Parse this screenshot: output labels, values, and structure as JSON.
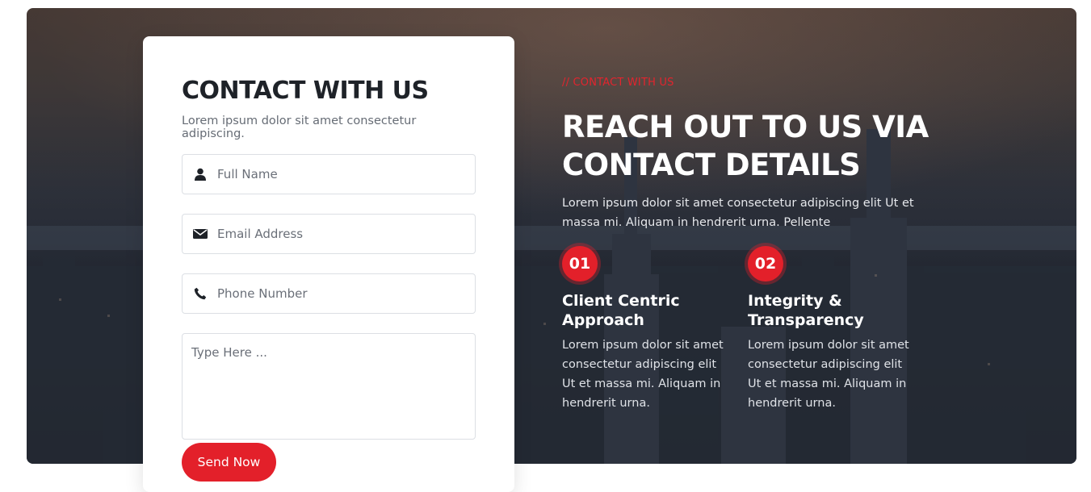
{
  "form": {
    "title": "CONTACT WITH US",
    "subtitle": "Lorem ipsum dolor sit amet consectetur adipiscing.",
    "fields": [
      {
        "placeholder": "Full Name",
        "icon": "user-icon"
      },
      {
        "placeholder": "Email Address",
        "icon": "envelope-icon"
      },
      {
        "placeholder": "Phone Number",
        "icon": "phone-icon"
      }
    ],
    "message_placeholder": "Type Here ...",
    "submit_label": "Send Now"
  },
  "info": {
    "eyebrow": "// CONTACT WITH US",
    "heading_line1": "REACH OUT TO US VIA",
    "heading_line2": "CONTACT DETAILS",
    "description": "Lorem ipsum dolor sit amet consectetur adipiscing elit Ut et massa mi. Aliquam in hendrerit urna. Pellente",
    "features": [
      {
        "number": "01",
        "title": "Client Centric Approach",
        "text": "Lorem ipsum dolor sit amet consectetur adipiscing elit Ut et massa mi. Aliquam in hendrerit urna."
      },
      {
        "number": "02",
        "title": "Integrity & Transparency",
        "text": "Lorem ipsum dolor sit amet consectetur adipiscing elit Ut et massa mi. Aliquam in hendrerit urna."
      }
    ]
  },
  "colors": {
    "accent": "#e3202a",
    "heading": "#1e2228",
    "text_muted": "#666c75"
  }
}
